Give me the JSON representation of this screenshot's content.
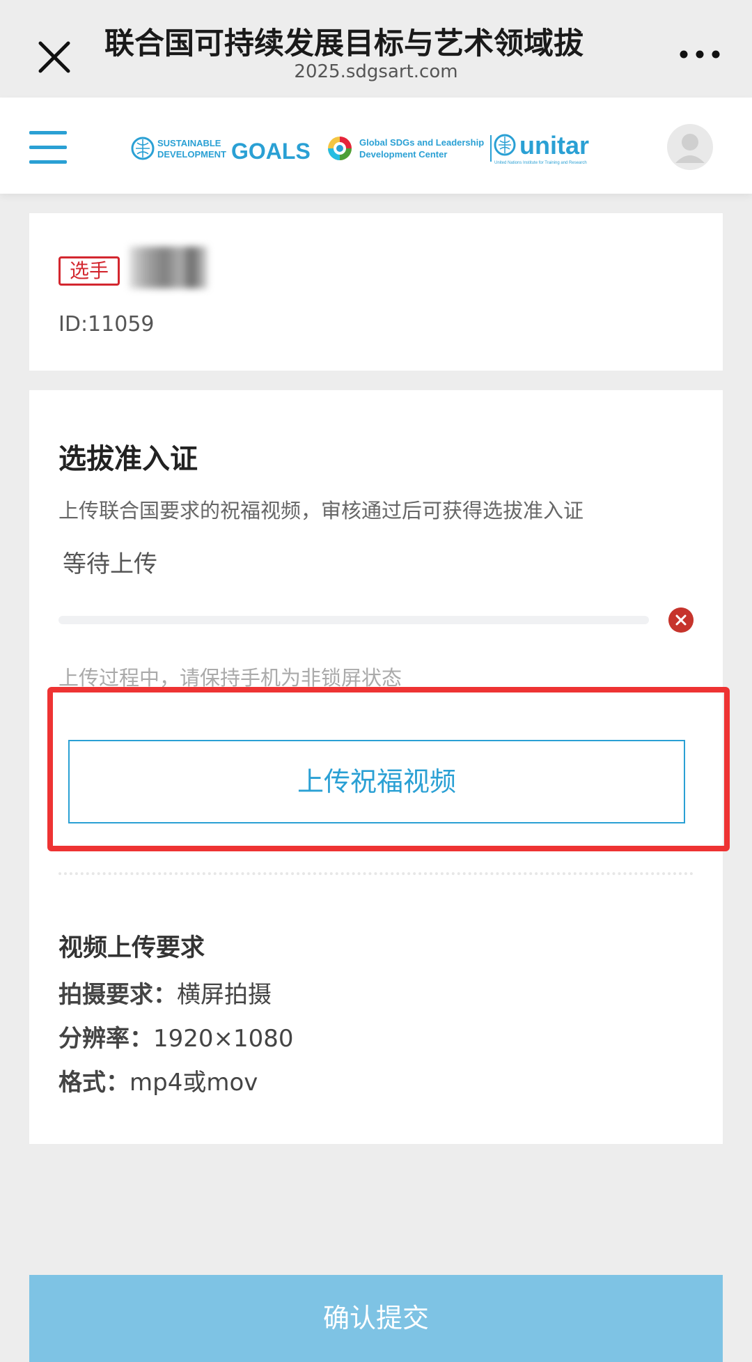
{
  "topbar": {
    "title": "联合国可持续发展目标与艺术领域拔",
    "domain": "2025.sdgsart.com",
    "close_icon": "close-icon",
    "more_icon": "more-icon"
  },
  "header": {
    "menu_icon": "hamburger-menu-icon",
    "logos": {
      "sdg_top": "SUSTAINABLE",
      "sdg_bottom": "DEVELOPMENT",
      "sdg_goals": "GOALS",
      "global_line1": "Global SDGs and Leadership",
      "global_line2": "Development Center",
      "unitar": "unitar",
      "unitar_sub": "United Nations Institute for Training and Research"
    },
    "avatar_icon": "avatar-icon"
  },
  "user": {
    "tag": "选手",
    "id_text": "ID:11059"
  },
  "pass_card": {
    "title": "选拔准入证",
    "description": "上传联合国要求的祝福视频，审核通过后可获得选拔准入证",
    "status": "等待上传",
    "progress": 0,
    "hint": "上传过程中，请保持手机为非锁屏状态",
    "upload_button": "上传祝福视频"
  },
  "requirements": {
    "title": "视频上传要求",
    "items": [
      {
        "label": "拍摄要求：",
        "value": "横屏拍摄"
      },
      {
        "label": "分辨率：",
        "value": "1920×1080"
      },
      {
        "label": "格式：",
        "value": "mp4或mov"
      }
    ]
  },
  "submit_button": "确认提交",
  "colors": {
    "accent": "#2aa0d4",
    "tag_red": "#d3272f",
    "highlight_red": "#ee3333",
    "submit_bg": "#7ec3e4"
  }
}
